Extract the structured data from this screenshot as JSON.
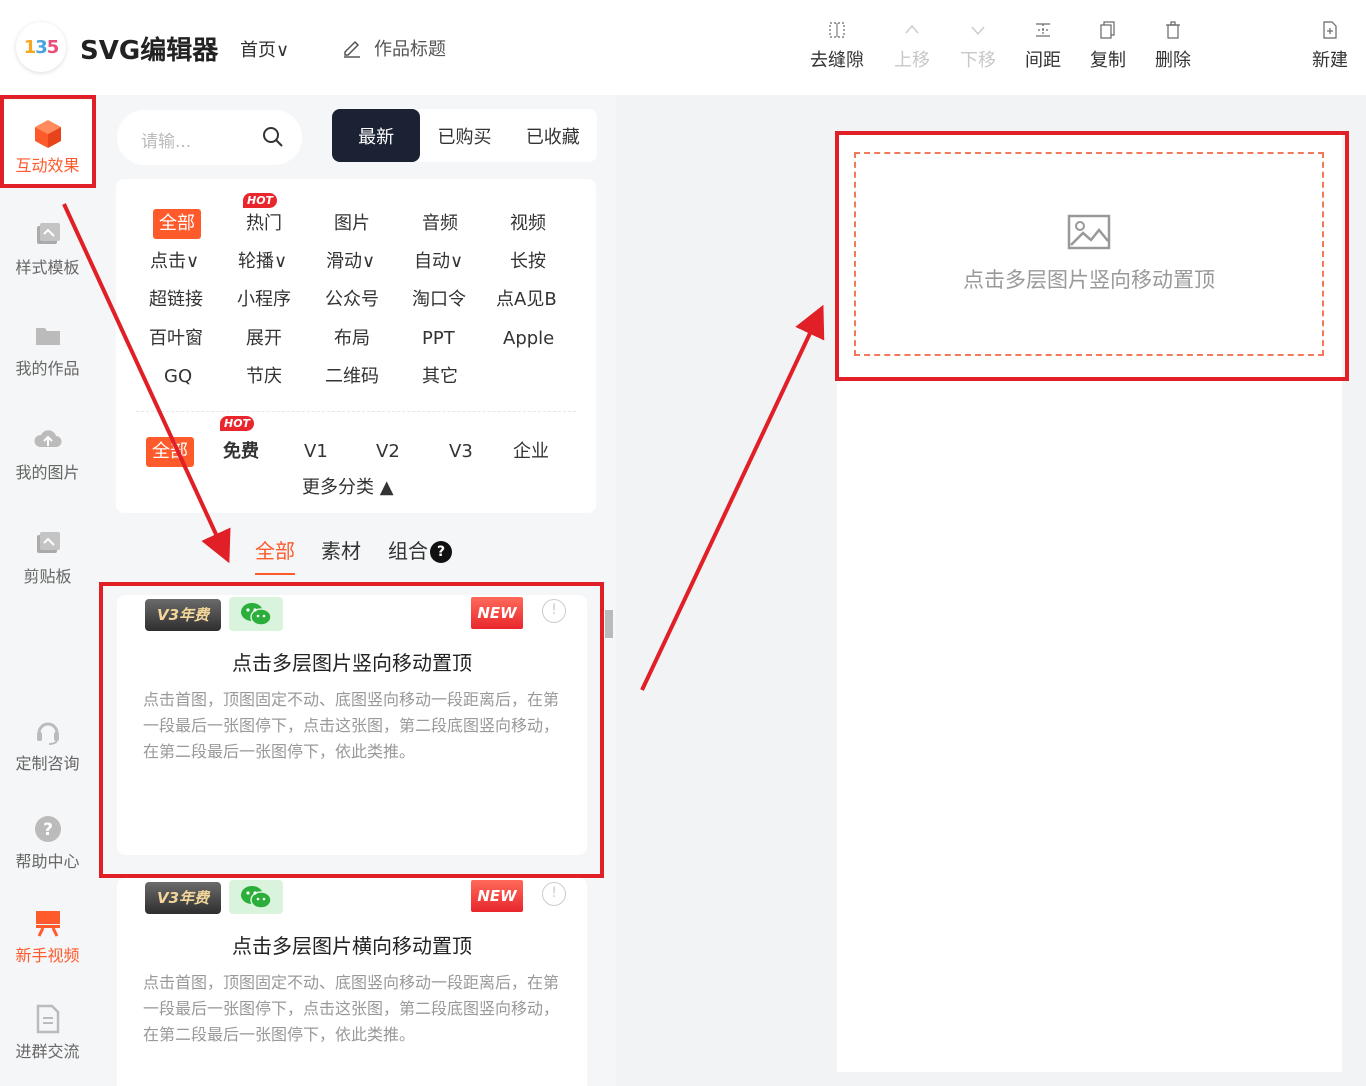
{
  "app": {
    "logo_text": "135",
    "name": "SVG编辑器",
    "home_label": "首页∨",
    "title_label": "作品标题"
  },
  "toolbar": {
    "items": [
      {
        "label": "去缝隙",
        "icon": "grid-icon",
        "disabled": false
      },
      {
        "label": "上移",
        "icon": "chevron-up-icon",
        "disabled": true
      },
      {
        "label": "下移",
        "icon": "chevron-down-icon",
        "disabled": true
      },
      {
        "label": "间距",
        "icon": "spacing-icon",
        "disabled": false
      },
      {
        "label": "复制",
        "icon": "copy-icon",
        "disabled": false
      },
      {
        "label": "删除",
        "icon": "trash-icon",
        "disabled": false
      },
      {
        "label": "新建",
        "icon": "new-file-icon",
        "disabled": false
      }
    ]
  },
  "sidebar": {
    "items": [
      {
        "label": "互动效果",
        "icon": "cube-icon",
        "active": true
      },
      {
        "label": "样式模板",
        "icon": "template-icon"
      },
      {
        "label": "我的作品",
        "icon": "folder-icon"
      },
      {
        "label": "我的图片",
        "icon": "cloud-upload-icon"
      },
      {
        "label": "剪贴板",
        "icon": "clipboard-icon"
      },
      {
        "label": "定制咨询",
        "icon": "headset-icon"
      },
      {
        "label": "帮助中心",
        "icon": "help-icon"
      },
      {
        "label": "新手视频",
        "icon": "video-icon"
      },
      {
        "label": "进群交流",
        "icon": "document-icon"
      }
    ]
  },
  "search": {
    "placeholder": "请输..."
  },
  "filter_tabs": [
    {
      "label": "最新",
      "active": true
    },
    {
      "label": "已购买"
    },
    {
      "label": "已收藏"
    }
  ],
  "categories": {
    "hot_badge": "HOT",
    "rows": [
      [
        "全部",
        "热门",
        "图片",
        "音频",
        "视频"
      ],
      [
        "点击∨",
        "轮播∨",
        "滑动∨",
        "自动∨",
        "长按"
      ],
      [
        "超链接",
        "小程序",
        "公众号",
        "淘口令",
        "点A见B"
      ],
      [
        "百叶窗",
        "展开",
        "布局",
        "PPT",
        "Apple"
      ],
      [
        "GQ",
        "节庆",
        "二维码",
        "其它"
      ]
    ],
    "price_row": [
      "全部",
      "免费",
      "V1",
      "V2",
      "V3",
      "企业"
    ],
    "more_label": "更多分类 ▲"
  },
  "sub_tabs": [
    "全部",
    "素材",
    "组合"
  ],
  "cards": [
    {
      "badge_v3": "V3年费",
      "badge_new": "NEW",
      "title": "点击多层图片竖向移动置顶",
      "desc": "点击首图，顶图固定不动、底图竖向移动一段距离后，在第一段最后一张图停下，点击这张图，第二段底图竖向移动，在第二段最后一张图停下，依此类推。"
    },
    {
      "badge_v3": "V3年费",
      "badge_new": "NEW",
      "title": "点击多层图片横向移动置顶",
      "desc": "点击首图，顶图固定不动、底图竖向移动一段距离后，在第一段最后一张图停下，点击这张图，第二段底图竖向移动，在第二段最后一张图停下，依此类推。"
    }
  ],
  "canvas": {
    "placeholder_text": "点击多层图片竖向移动置顶"
  },
  "colors": {
    "accent": "#ff5a2c",
    "annotation": "#e01f26",
    "dark_tab": "#1b2233"
  }
}
